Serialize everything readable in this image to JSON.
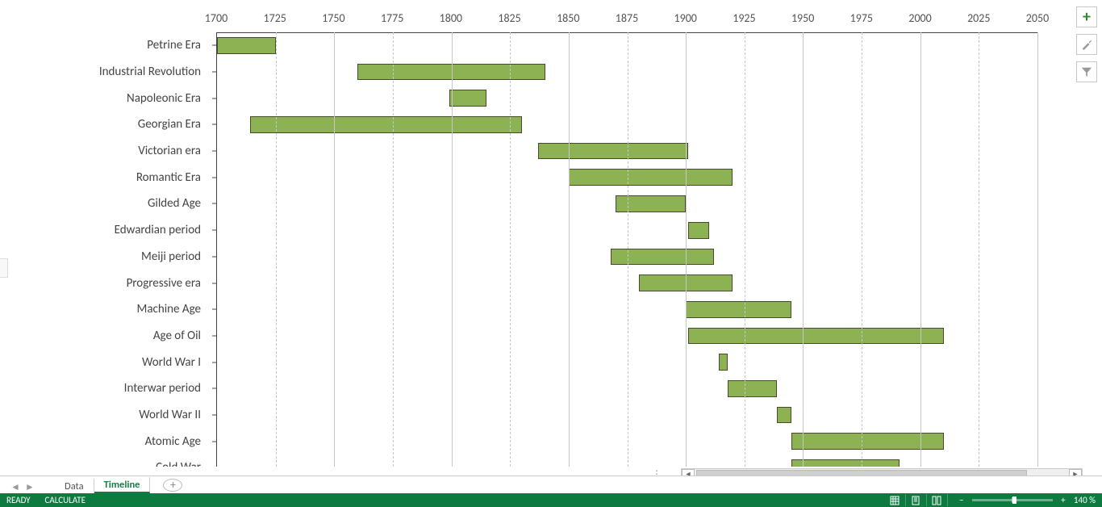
{
  "chart_data": {
    "type": "bar",
    "orientation": "horizontal-range",
    "x_axis": {
      "min": 1700,
      "max": 2050,
      "major_step": 50,
      "minor_step": 25,
      "position": "top"
    },
    "ticks": [
      1700,
      1725,
      1750,
      1775,
      1800,
      1825,
      1850,
      1875,
      1900,
      1925,
      1950,
      1975,
      2000,
      2025,
      2050
    ],
    "series": [
      {
        "label": "Petrine Era",
        "start": 1689,
        "end": 1725
      },
      {
        "label": "Industrial Revolution",
        "start": 1760,
        "end": 1840
      },
      {
        "label": "Napoleonic Era",
        "start": 1799,
        "end": 1815
      },
      {
        "label": "Georgian Era",
        "start": 1714,
        "end": 1830
      },
      {
        "label": "Victorian era",
        "start": 1837,
        "end": 1901
      },
      {
        "label": "Romantic Era",
        "start": 1850,
        "end": 1920
      },
      {
        "label": "Gilded Age",
        "start": 1870,
        "end": 1900
      },
      {
        "label": "Edwardian period",
        "start": 1901,
        "end": 1910
      },
      {
        "label": "Meiji period",
        "start": 1868,
        "end": 1912
      },
      {
        "label": "Progressive era",
        "start": 1880,
        "end": 1920
      },
      {
        "label": "Machine Age",
        "start": 1900,
        "end": 1945
      },
      {
        "label": "Age of Oil",
        "start": 1901,
        "end": 2010
      },
      {
        "label": "World War I",
        "start": 1914,
        "end": 1918
      },
      {
        "label": "Interwar period",
        "start": 1918,
        "end": 1939
      },
      {
        "label": "World War II",
        "start": 1939,
        "end": 1945
      },
      {
        "label": "Atomic Age",
        "start": 1945,
        "end": 2010
      },
      {
        "label": "Cold War",
        "start": 1945,
        "end": 1991
      }
    ],
    "bar_color": "#8db253",
    "bar_border": "#474a2b"
  },
  "tabs": {
    "items": [
      "Data",
      "Timeline"
    ],
    "active_index": 1
  },
  "status": {
    "ready": "READY",
    "calculate": "CALCULATE",
    "zoom_label": "140 %"
  }
}
